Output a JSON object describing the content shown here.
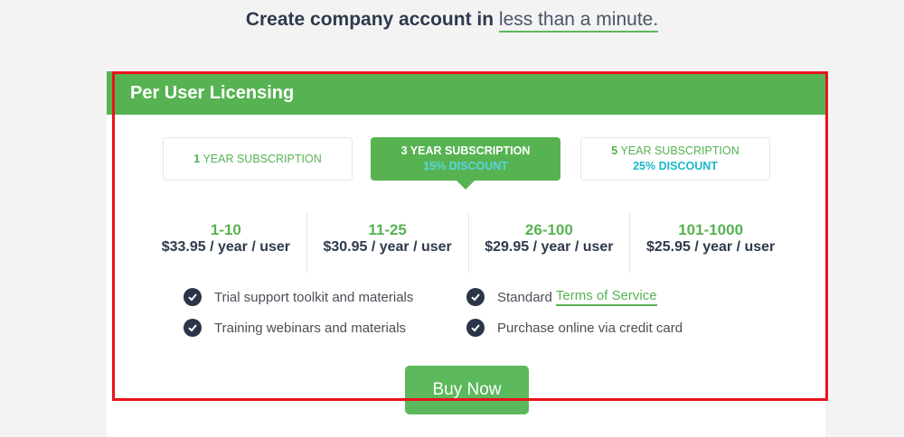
{
  "headline": {
    "strong": "Create company account in",
    "light": "less than a minute."
  },
  "card": {
    "title": "Per User Licensing",
    "tabs": [
      {
        "num": "1",
        "label": "YEAR SUBSCRIPTION",
        "discount": ""
      },
      {
        "num": "3",
        "label": "YEAR SUBSCRIPTION",
        "discount": "15% DISCOUNT"
      },
      {
        "num": "5",
        "label": "YEAR SUBSCRIPTION",
        "discount": "25% DISCOUNT"
      }
    ],
    "active_tab": 1,
    "tiers": [
      {
        "range": "1-10",
        "price": "$33.95 / year / user"
      },
      {
        "range": "11-25",
        "price": "$30.95 / year / user"
      },
      {
        "range": "26-100",
        "price": "$29.95 / year / user"
      },
      {
        "range": "101-1000",
        "price": "$25.95 / year / user"
      }
    ],
    "features": [
      {
        "text": "Trial support toolkit and materials"
      },
      {
        "text": "Standard",
        "link": "Terms of Service"
      },
      {
        "text": "Training webinars and materials"
      },
      {
        "text": "Purchase online via credit card"
      }
    ],
    "buy_label": "Buy Now"
  },
  "colors": {
    "brand_green": "#57b352",
    "discount_teal": "#19b8c9",
    "check_navy": "#2b3448",
    "highlight_red": "#e8141c"
  }
}
